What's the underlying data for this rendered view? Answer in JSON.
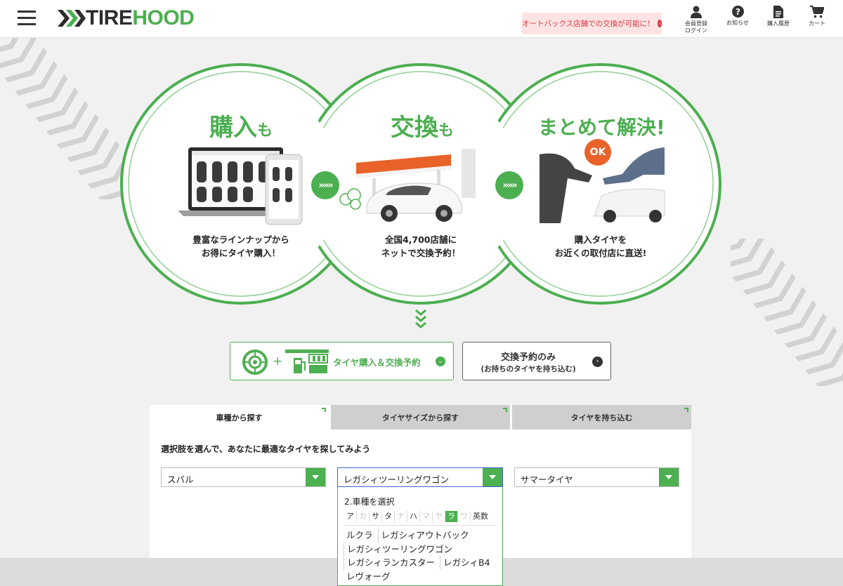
{
  "header": {
    "logo": {
      "part1": "TIRE",
      "part2": "HOOD"
    },
    "promo": "オートバックス店舗での交換が可能に！",
    "nav": [
      {
        "label": "会員登録\nログイン",
        "icon": "user-icon"
      },
      {
        "label": "お知らせ",
        "icon": "question-icon"
      },
      {
        "label": "購入履歴",
        "icon": "document-icon"
      },
      {
        "label": "カート",
        "icon": "cart-icon"
      }
    ]
  },
  "hero": {
    "circles": [
      {
        "title_main": "購入",
        "title_suffix": "も",
        "caption1": "豊富なラインナップから",
        "caption2": "お得にタイヤ購入！"
      },
      {
        "title_main": "交換",
        "title_suffix": "も",
        "caption1": "全国4,700店舗に",
        "caption2": "ネットで交換予約！"
      },
      {
        "title_main": "まとめて解決!",
        "badge": "OK",
        "caption1": "購入タイヤを",
        "caption2": "お近くの取付店に直送!"
      }
    ],
    "arrow_glyph": "»»»"
  },
  "cta": {
    "purchase_exchange": "タイヤ購入＆交換予約",
    "exchange_only_line1": "交換予約のみ",
    "exchange_only_line2": "(お持ちのタイヤを持ち込む)"
  },
  "search": {
    "tabs": [
      {
        "label": "車種から探す",
        "active": true
      },
      {
        "label": "タイヤサイズから探す",
        "active": false
      },
      {
        "label": "タイヤを持ち込む",
        "active": false
      }
    ],
    "instruction": "選択肢を選んで、あなたに最適なタイヤを探してみよう",
    "maker": "スバル",
    "model": "レガシィツーリングワゴン",
    "season": "サマータイヤ"
  },
  "dropdown": {
    "title": "2.車種を選択",
    "kana": [
      {
        "k": "ア",
        "state": "normal"
      },
      {
        "k": "カ",
        "state": "disabled"
      },
      {
        "k": "サ",
        "state": "normal"
      },
      {
        "k": "タ",
        "state": "normal"
      },
      {
        "k": "ナ",
        "state": "disabled"
      },
      {
        "k": "ハ",
        "state": "normal"
      },
      {
        "k": "マ",
        "state": "disabled"
      },
      {
        "k": "ヤ",
        "state": "disabled"
      },
      {
        "k": "ラ",
        "state": "active"
      },
      {
        "k": "ワ",
        "state": "disabled"
      },
      {
        "k": "英数",
        "state": "normal"
      }
    ],
    "models": [
      "ルクラ",
      "レガシィアウトバック",
      "レガシィツーリングワゴン",
      "レガシィランカスター",
      "レガシィB4",
      "レヴォーグ"
    ]
  },
  "colors": {
    "brand": "#4caf50",
    "promo_bg": "#fde3e3",
    "promo_text": "#d9363e"
  }
}
